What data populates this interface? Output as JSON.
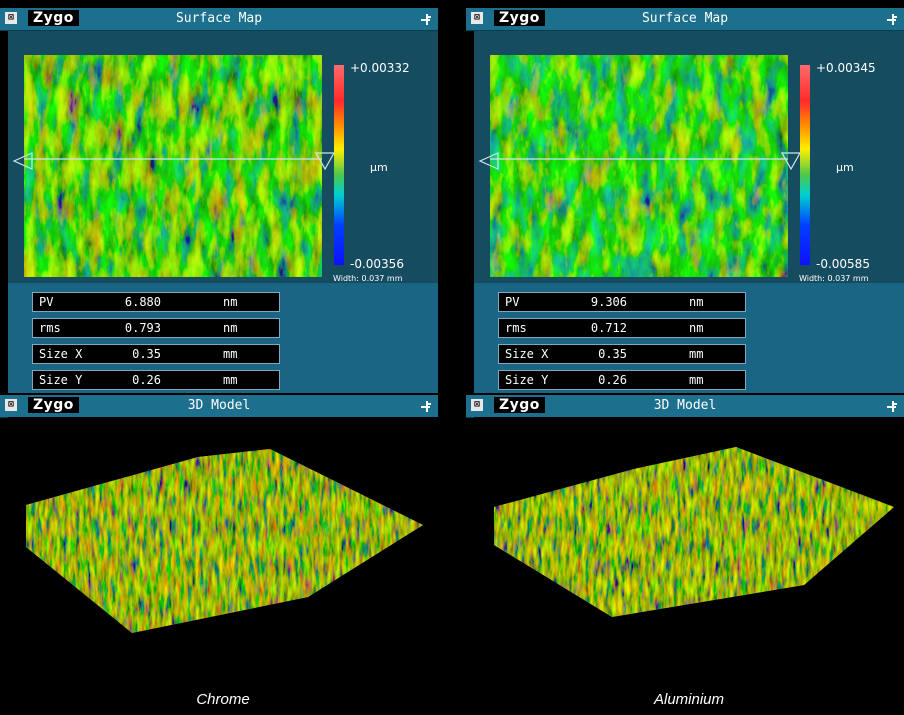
{
  "panels": [
    {
      "logo": "Zygo",
      "surface_title": "Surface Map",
      "scale": {
        "max": "+0.00332",
        "unit": "µm",
        "min": "-0.00356",
        "width": "Width: 0.037 mm"
      },
      "stats": [
        {
          "label": "PV",
          "value": "6.880",
          "unit": "nm"
        },
        {
          "label": "rms",
          "value": "0.793",
          "unit": "nm"
        },
        {
          "label": "Size X",
          "value": "0.35",
          "unit": "mm"
        },
        {
          "label": "Size Y",
          "value": "0.26",
          "unit": "mm"
        }
      ],
      "model_title": "3D Model",
      "caption": "Chrome"
    },
    {
      "logo": "Zygo",
      "surface_title": "Surface Map",
      "scale": {
        "max": "+0.00345",
        "unit": "µm",
        "min": "-0.00585",
        "width": "Width: 0.037 mm"
      },
      "stats": [
        {
          "label": "PV",
          "value": "9.306",
          "unit": "nm"
        },
        {
          "label": "rms",
          "value": "0.712",
          "unit": "nm"
        },
        {
          "label": "Size X",
          "value": "0.35",
          "unit": "mm"
        },
        {
          "label": "Size Y",
          "value": "0.26",
          "unit": "mm"
        }
      ],
      "model_title": "3D Model",
      "caption": "Aluminium"
    }
  ],
  "icons": {
    "close": "close-box-icon",
    "pin": "pin-icon"
  },
  "colors": {
    "title_bar": "#1c6f8d",
    "panel": "#164c5f",
    "stats_bg": "#1a6584"
  }
}
